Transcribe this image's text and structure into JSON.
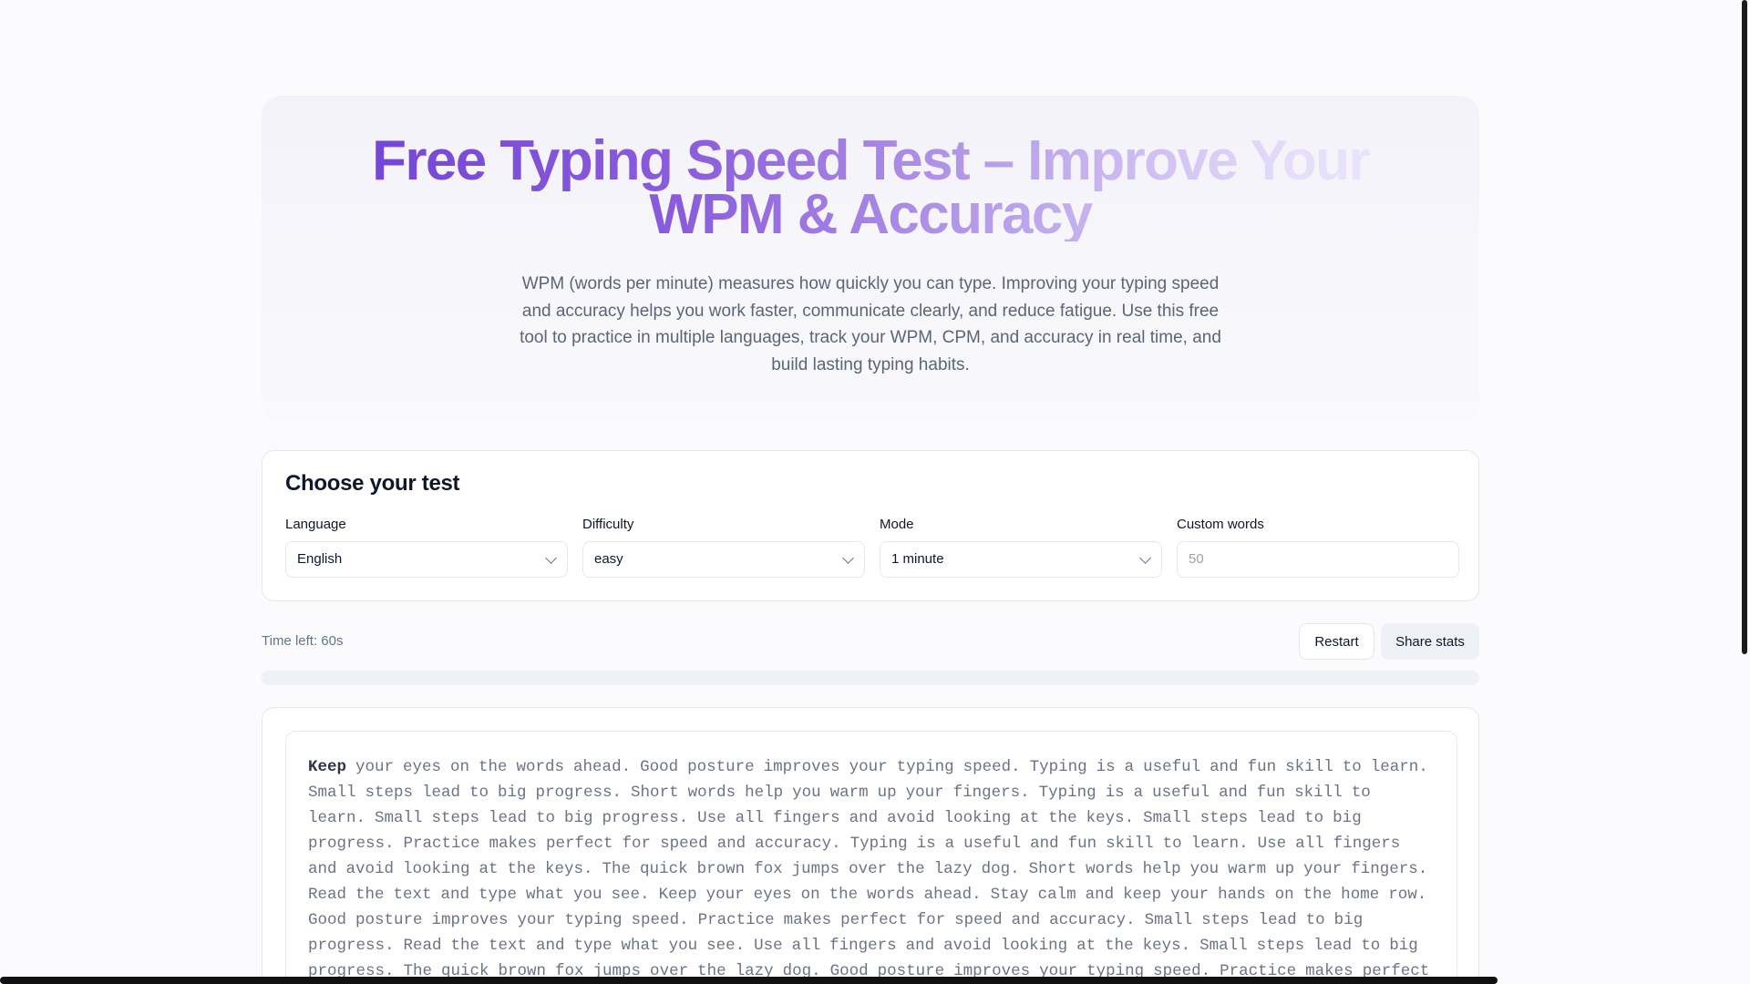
{
  "hero": {
    "title": "Free Typing Speed Test – Improve Your WPM & Accuracy",
    "description": "WPM (words per minute) measures how quickly you can type. Improving your typing speed and accuracy helps you work faster, communicate clearly, and reduce fatigue. Use this free tool to practice in multiple languages, track your WPM, CPM, and accuracy in real time, and build lasting typing habits."
  },
  "choose": {
    "heading": "Choose your test",
    "language": {
      "label": "Language",
      "value": "English"
    },
    "difficulty": {
      "label": "Difficulty",
      "value": "easy"
    },
    "mode": {
      "label": "Mode",
      "value": "1 minute"
    },
    "custom_words": {
      "label": "Custom words",
      "placeholder": "50"
    }
  },
  "status": {
    "time_left": "Time left: 60s",
    "progress_percent": 0
  },
  "buttons": {
    "restart": "Restart",
    "share": "Share stats"
  },
  "typing": {
    "current_word": "Keep",
    "rest": " your eyes on the words ahead. Good posture improves your typing speed. Typing is a useful and fun skill to learn. Small steps lead to big progress. Short words help you warm up your fingers. Typing is a useful and fun skill to learn. Small steps lead to big progress. Use all fingers and avoid looking at the keys. Small steps lead to big progress. Practice makes perfect for speed and accuracy. Typing is a useful and fun skill to learn. Use all fingers and avoid looking at the keys. The quick brown fox jumps over the lazy dog. Short words help you warm up your fingers. Read the text and type what you see. Keep your eyes on the words ahead. Stay calm and keep your hands on the home row. Good posture improves your typing speed. Practice makes perfect for speed and accuracy. Small steps lead to big progress. Read the text and type what you see. Use all fingers and avoid looking at the keys. Small steps lead to big progress. The quick brown fox jumps over the lazy dog. Good posture improves your typing speed. Practice makes perfect for speed and accuracy. Use all fingers and"
  },
  "colors": {
    "accent": "#6b3fd4",
    "muted_text": "#64748b",
    "border": "#e5e7eb"
  }
}
